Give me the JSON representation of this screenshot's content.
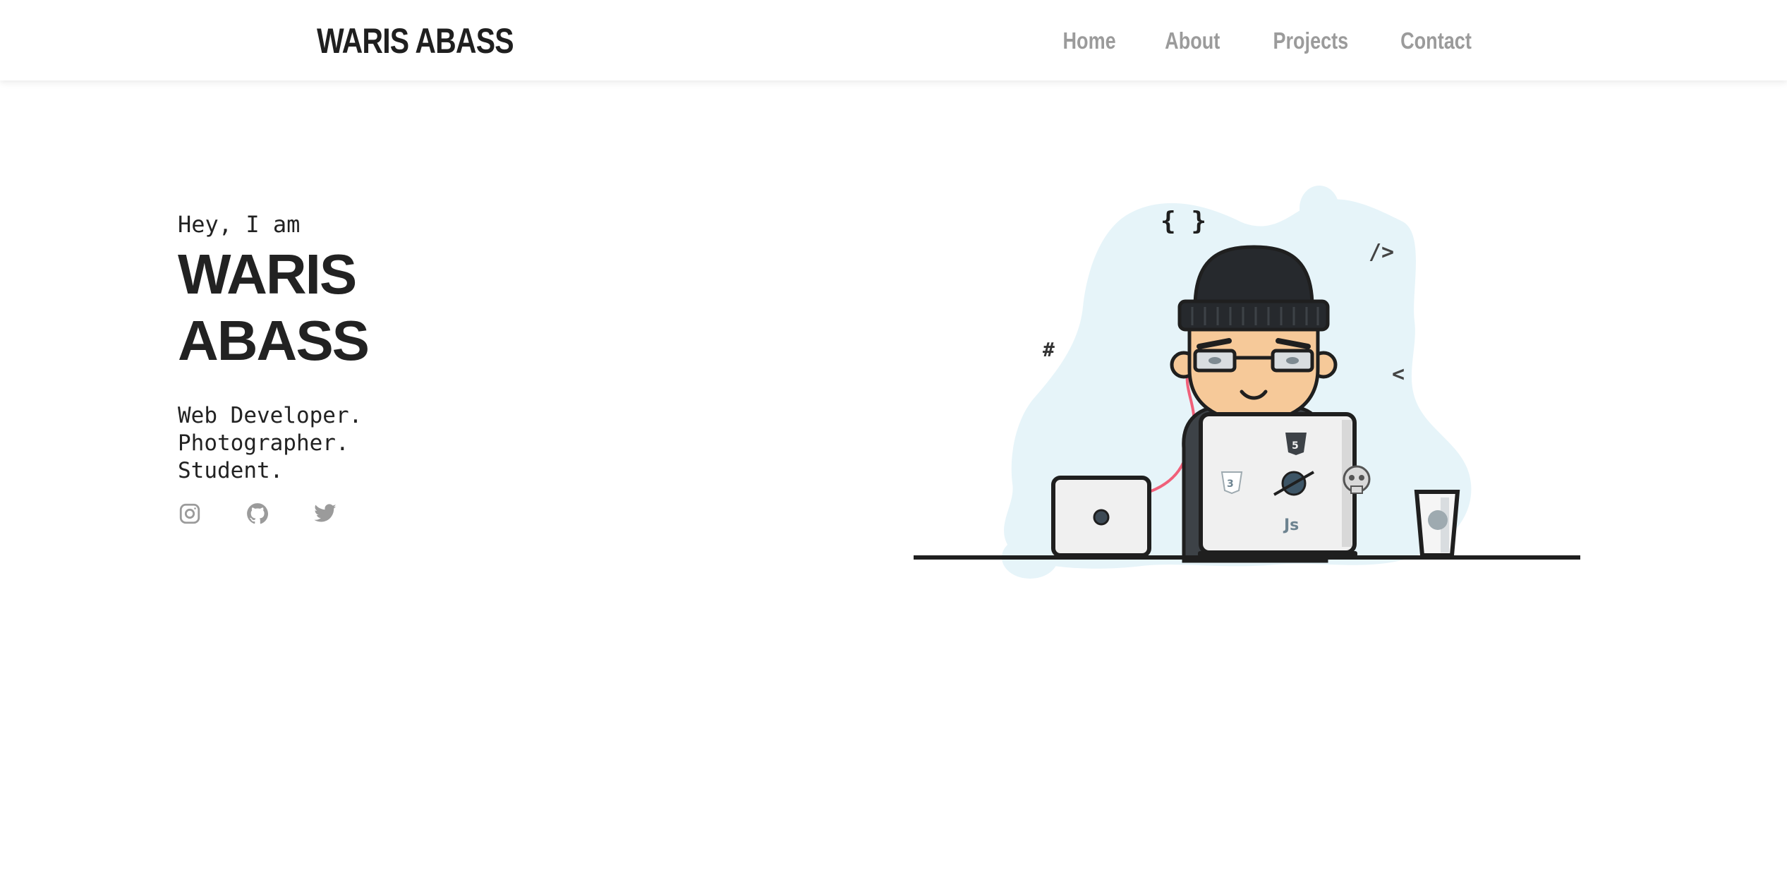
{
  "header": {
    "brand": "WARIS ABASS",
    "nav": [
      {
        "label": "Home"
      },
      {
        "label": "About"
      },
      {
        "label": "Projects"
      },
      {
        "label": "Contact"
      }
    ]
  },
  "hero": {
    "greeting": "Hey, I am",
    "name_line1": "WARIS",
    "name_line2": "ABASS",
    "roles": [
      "Web Developer.",
      "Photographer.",
      "Student."
    ],
    "socials": [
      {
        "icon": "instagram-icon"
      },
      {
        "icon": "github-icon"
      },
      {
        "icon": "twitter-icon"
      }
    ],
    "illustration": {
      "symbols": [
        "{ }",
        "</>",
        "#",
        "<",
        "Js"
      ],
      "colors": {
        "blob": "#e6f4f9",
        "outline": "#1f1f1f",
        "skin": "#f6c999",
        "beanie": "#26292d",
        "laptop": "#f0f0f0",
        "cable": "#f0607a",
        "icon_gray": "#9eaab0"
      }
    }
  },
  "colors": {
    "brand_text": "#1f1f1f",
    "nav_text": "#9b9b9b",
    "body_text": "#222222",
    "icon_gray": "#9b9b9b"
  }
}
